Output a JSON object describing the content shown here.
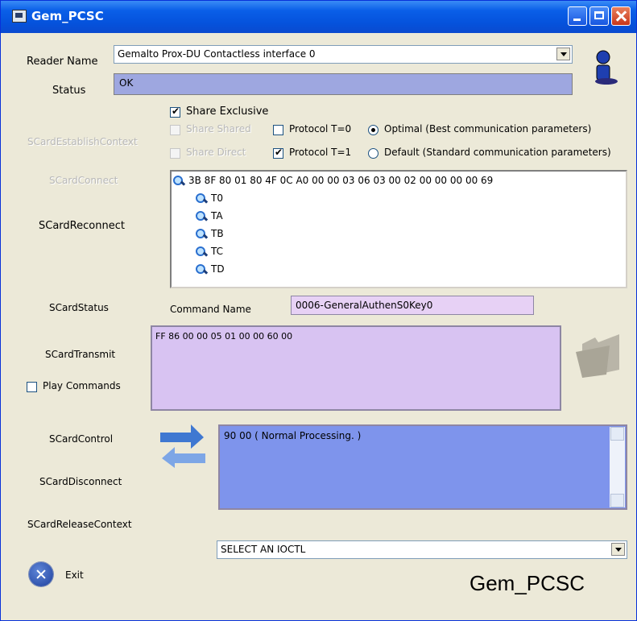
{
  "window": {
    "title": "Gem_PCSC"
  },
  "reader": {
    "label": "Reader Name",
    "value": "Gemalto Prox-DU Contactless interface 0"
  },
  "status": {
    "label": "Status",
    "value": "OK"
  },
  "actions": {
    "establish": "SCardEstablishContext",
    "connect": "SCardConnect",
    "reconnect": "SCardReconnect",
    "status": "SCardStatus",
    "transmit": "SCardTransmit",
    "control": "SCardControl",
    "disconnect": "SCardDisconnect",
    "release": "SCardReleaseContext",
    "exit": "Exit"
  },
  "options": {
    "share_exclusive": "Share Exclusive",
    "share_shared": "Share Shared",
    "share_direct": "Share Direct",
    "protocol_t0": "Protocol T=0",
    "protocol_t1": "Protocol T=1",
    "optimal": "Optimal (Best communication parameters)",
    "default": "Default (Standard communication parameters)"
  },
  "atr_tree": {
    "root": "3B 8F 80 01 80 4F 0C A0 00 00 03 06 03 00 02 00 00 00 00 69",
    "children": [
      "T0",
      "TA",
      "TB",
      "TC",
      "TD"
    ]
  },
  "command": {
    "label": "Command Name",
    "value": "0006-GeneralAuthenS0Key0"
  },
  "apdu": {
    "value": "FF 86 00 00 05 01 00 00 60 00"
  },
  "play_commands": "Play Commands",
  "response": {
    "value": "90 00  ( Normal Processing. )"
  },
  "ioctl": {
    "value": "SELECT AN IOCTL"
  },
  "brand": "Gem_PCSC",
  "colors": {
    "titlebar": "#0552dc",
    "status_bg": "#9ea7e0",
    "apdu_bg": "#d8c3f2",
    "response_bg": "#7e94ec",
    "command_bg": "#e7d1f5"
  }
}
